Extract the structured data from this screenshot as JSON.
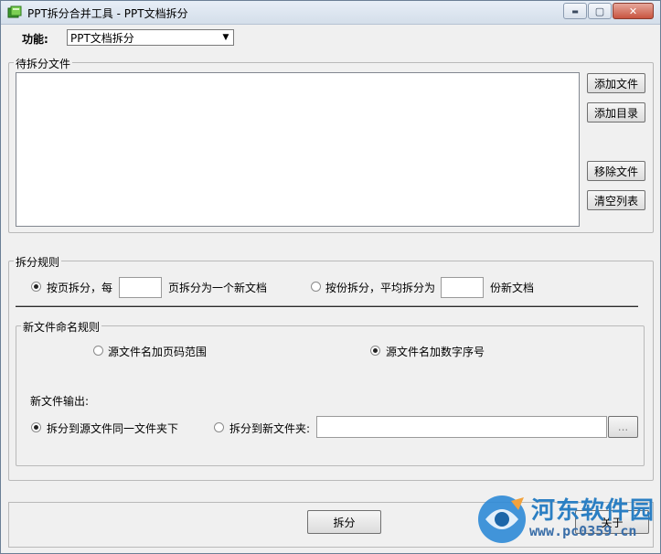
{
  "window": {
    "title": "PPT拆分合并工具 - PPT文档拆分",
    "min_symbol": "▬",
    "max_symbol": "▢",
    "close_symbol": "✕"
  },
  "function": {
    "label": "功能:",
    "selected": "PPT文档拆分"
  },
  "files_group": {
    "label": "待拆分文件",
    "add_file": "添加文件",
    "add_dir": "添加目录",
    "remove_file": "移除文件",
    "clear_list": "清空列表"
  },
  "split_rules": {
    "label": "拆分规则",
    "by_page_prefix": "按页拆分，每",
    "by_page_value": "",
    "by_page_suffix": "页拆分为一个新文档",
    "by_count_prefix": "按份拆分，平均拆分为",
    "by_count_value": "",
    "by_count_suffix": "份新文档",
    "selected": "by_page"
  },
  "naming": {
    "label": "新文件命名规则",
    "option_page_range": "源文件名加页码范围",
    "option_number": "源文件名加数字序号",
    "selected": "number",
    "output_label": "新文件输出:",
    "output_same": "拆分到源文件同一文件夹下",
    "output_new": "拆分到新文件夹:",
    "output_path": "",
    "browse": "...",
    "output_selected": "same"
  },
  "footer": {
    "split_button": "拆分",
    "close_button": "关于"
  },
  "watermark": {
    "line1": "河东软件园",
    "line2": "www.pc0359.cn"
  },
  "colors": {
    "accent": "#2b7fc3",
    "title_bar": "#dbe4ef",
    "close_button": "#c8543f"
  }
}
